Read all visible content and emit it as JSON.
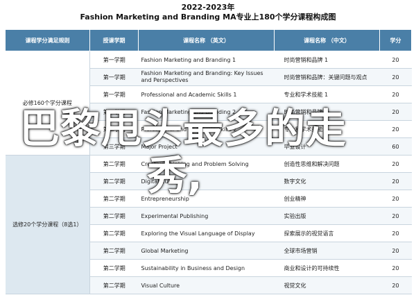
{
  "title": {
    "line1": "2022-2023年",
    "line2": "Fashion Marketing and Branding MA专业上180个学分课程构成图"
  },
  "headers": {
    "group": "课程学分满足规则",
    "semester": "授课学期",
    "name_en": "课程名称 （英文）",
    "name_cn": "课程名称 （中文）",
    "credits": "学分"
  },
  "groups": {
    "required": "必修160个学分课程",
    "elective": "选修20个学分课程（8选1）"
  },
  "required_rows": [
    {
      "semester": "第一学期",
      "en": "Fashion Marketing and Branding 1",
      "cn": "时尚营销和品牌 1",
      "credits": "20"
    },
    {
      "semester": "第一学期",
      "en": "Fashion Marketing and Branding: Key Issues and Perspectives",
      "cn": "时尚营销和品牌：关键问题与观点",
      "credits": "20"
    },
    {
      "semester": "第一学期",
      "en": "Professional and Academic Skills 1",
      "cn": "专业和学术技能 1",
      "credits": "20"
    },
    {
      "semester": "第二学期",
      "en": "Fashion Marketing and Branding 2",
      "cn": "时尚营销和品牌 2",
      "credits": "20"
    },
    {
      "semester": "第二学期",
      "en": "Professional and Academic Skills 2",
      "cn": "专业和学术技能 2",
      "credits": "20"
    },
    {
      "semester": "第三学期",
      "en": "Major Project",
      "cn": "毕业设计",
      "credits": "60"
    }
  ],
  "elective_rows": [
    {
      "semester": "第二学期",
      "en": "Creative Thinking and Problem Solving",
      "cn": "创造性思维和解决问题",
      "credits": "20"
    },
    {
      "semester": "第二学期",
      "en": "Digital Culture",
      "cn": "数字文化",
      "credits": "20"
    },
    {
      "semester": "第二学期",
      "en": "Entrepreneurship",
      "cn": "创业精神",
      "credits": "20"
    },
    {
      "semester": "第二学期",
      "en": "Experimental Publishing",
      "cn": "实验出版",
      "credits": "20"
    },
    {
      "semester": "第二学期",
      "en": "Exploring the Visual Language of Display",
      "cn": "探索展示的视觉语言",
      "credits": "20"
    },
    {
      "semester": "第二学期",
      "en": "Global Marketing",
      "cn": "全球市场营销",
      "credits": "20"
    },
    {
      "semester": "第二学期",
      "en": "Sustainability in Business and Design",
      "cn": "商业和设计的可持续性",
      "credits": "20"
    },
    {
      "semester": "第二学期",
      "en": "Visual Culture",
      "cn": "视觉文化",
      "credits": "20"
    }
  ],
  "overlay": {
    "line1": "巴黎甩头最多的走",
    "line2": "秀,"
  }
}
